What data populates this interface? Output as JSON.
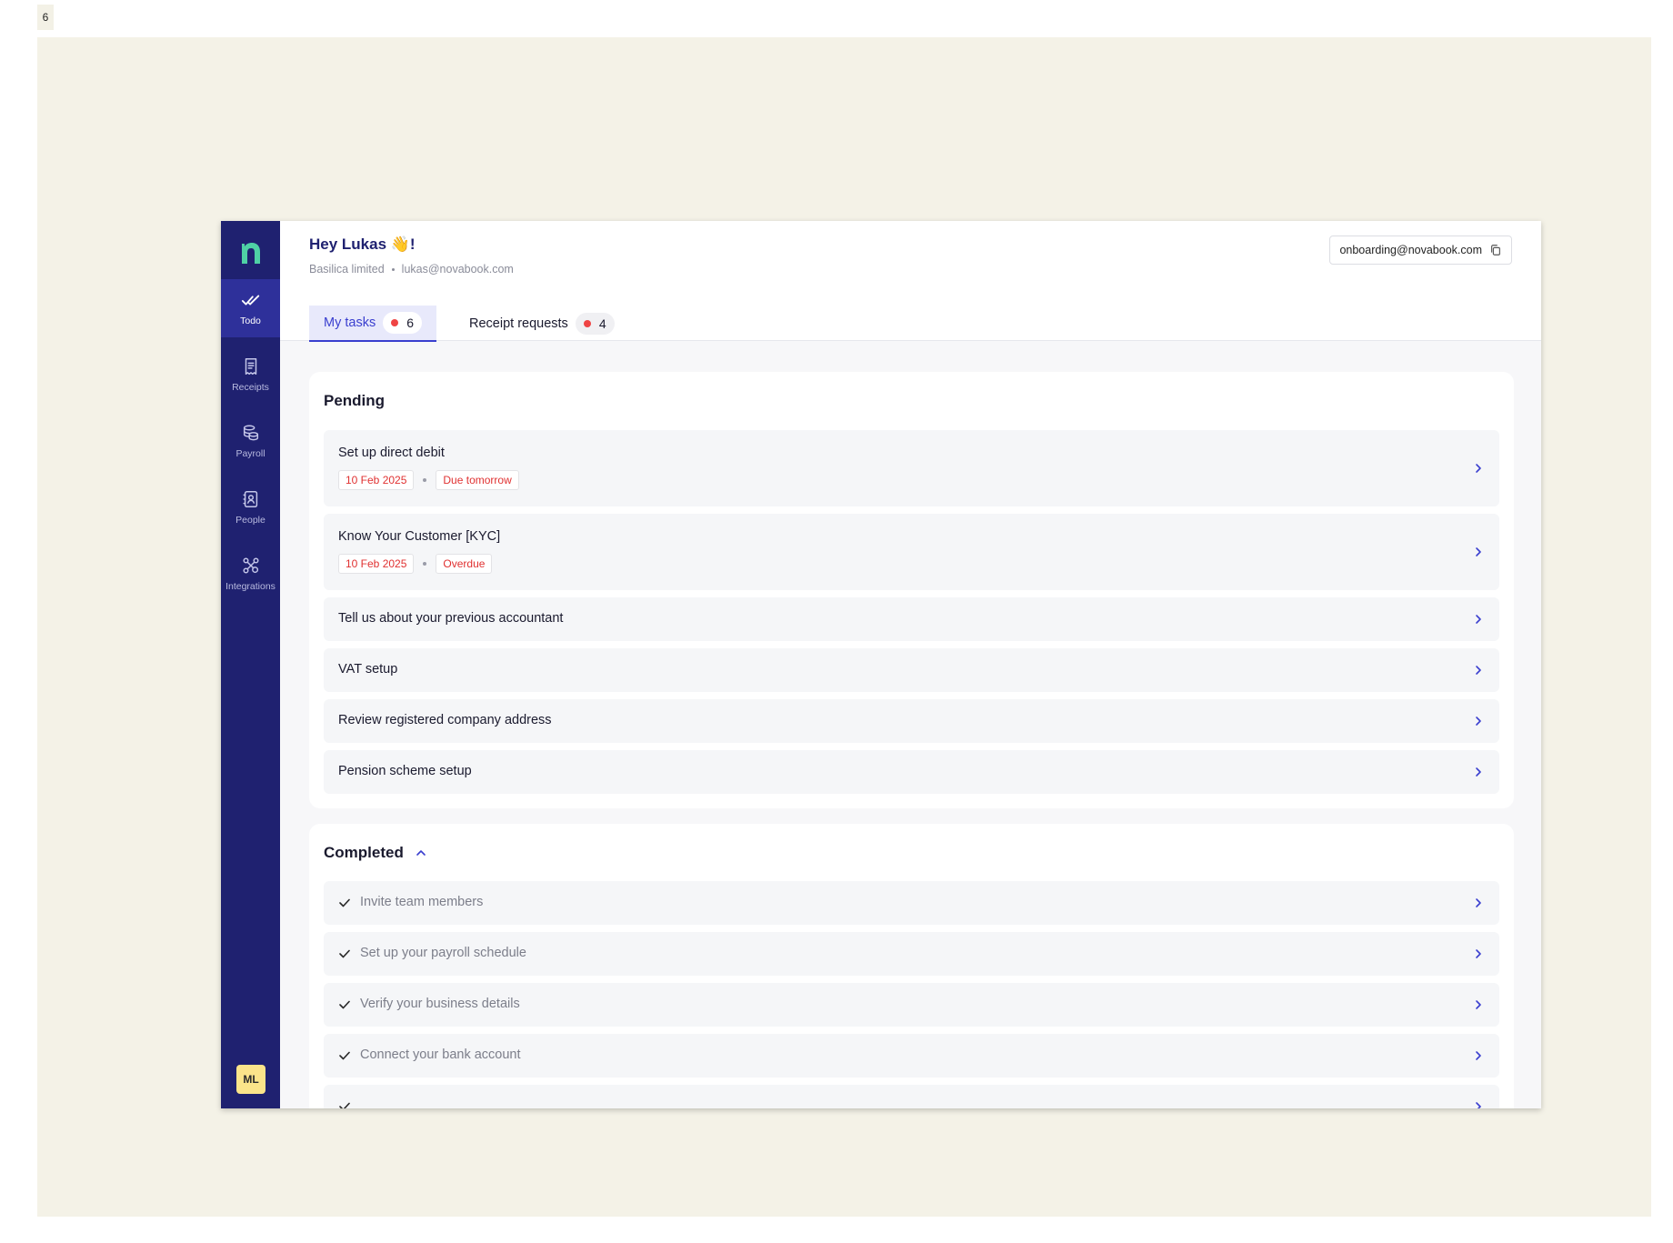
{
  "frame_label": "6",
  "sidebar": {
    "logo": "n",
    "items": [
      {
        "label": "Todo",
        "icon": "double-check-icon"
      },
      {
        "label": "Receipts",
        "icon": "receipt-icon"
      },
      {
        "label": "Payroll",
        "icon": "coins-icon"
      },
      {
        "label": "People",
        "icon": "contact-book-icon"
      },
      {
        "label": "Integrations",
        "icon": "integrations-icon"
      }
    ],
    "avatar_initials": "ML"
  },
  "header": {
    "greeting": "Hey Lukas 👋!",
    "company": "Basilica limited",
    "user_email": "lukas@novabook.com",
    "onboarding_email": "onboarding@novabook.com"
  },
  "tabs": [
    {
      "label": "My tasks",
      "count": "6"
    },
    {
      "label": "Receipt requests",
      "count": "4"
    }
  ],
  "pending": {
    "title": "Pending",
    "tasks": [
      {
        "title": "Set up direct debit",
        "date": "10 Feb 2025",
        "status": "Due tomorrow"
      },
      {
        "title": "Know Your Customer [KYC]",
        "date": "10 Feb 2025",
        "status": "Overdue"
      },
      {
        "title": "Tell us about your previous accountant"
      },
      {
        "title": "VAT setup"
      },
      {
        "title": "Review registered company address"
      },
      {
        "title": "Pension scheme setup"
      }
    ]
  },
  "completed": {
    "title": "Completed",
    "tasks": [
      {
        "title": "Invite team members"
      },
      {
        "title": "Set up your payroll schedule"
      },
      {
        "title": "Verify your business details"
      },
      {
        "title": "Connect your bank account"
      }
    ]
  },
  "colors": {
    "sidebar_bg": "#1f2170",
    "accent": "#3a3fcf",
    "logo": "#4fd1a5",
    "alert": "#ef4444"
  }
}
